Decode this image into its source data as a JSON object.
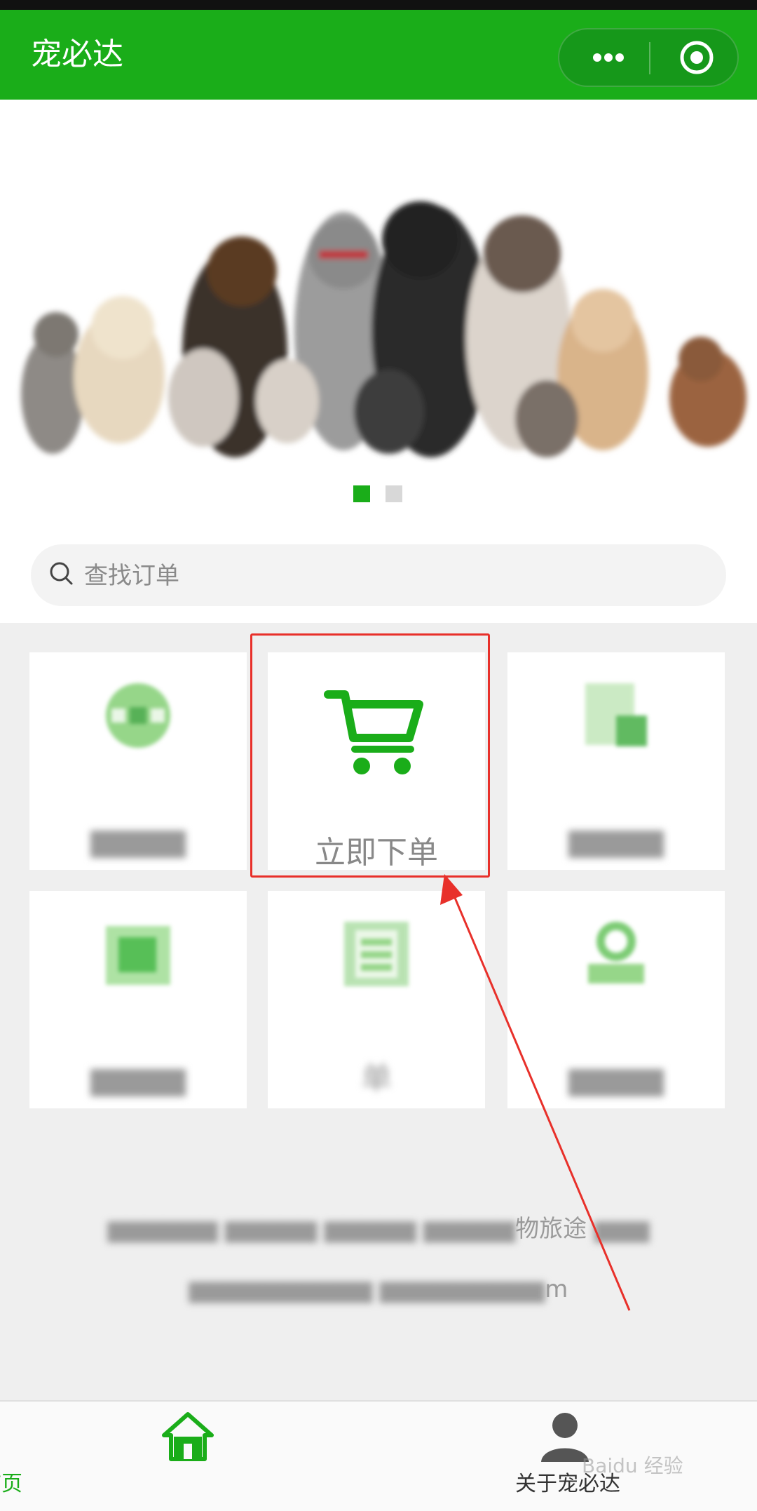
{
  "header": {
    "title": "宠必达"
  },
  "banner": {
    "active_index": 0,
    "count": 2
  },
  "search": {
    "placeholder": "查找订单",
    "value": ""
  },
  "grid": {
    "tiles": [
      {
        "label": "",
        "icon": "blurred-icon"
      },
      {
        "label": "立即下单",
        "icon": "cart-icon"
      },
      {
        "label": "",
        "icon": "blurred-icon"
      },
      {
        "label": "",
        "icon": "blurred-icon"
      },
      {
        "label": "单",
        "icon": "blurred-list-icon"
      },
      {
        "label": "",
        "icon": "blurred-user-icon"
      }
    ]
  },
  "footer": {
    "line1_visible": "物旅途",
    "line2_visible": "m"
  },
  "tabbar": {
    "home_label": "首页",
    "about_label": "关于宠必达"
  },
  "watermark": {
    "text": "Baidu 经验"
  },
  "colors": {
    "accent": "#1aad19",
    "highlight": "#e8302a"
  }
}
